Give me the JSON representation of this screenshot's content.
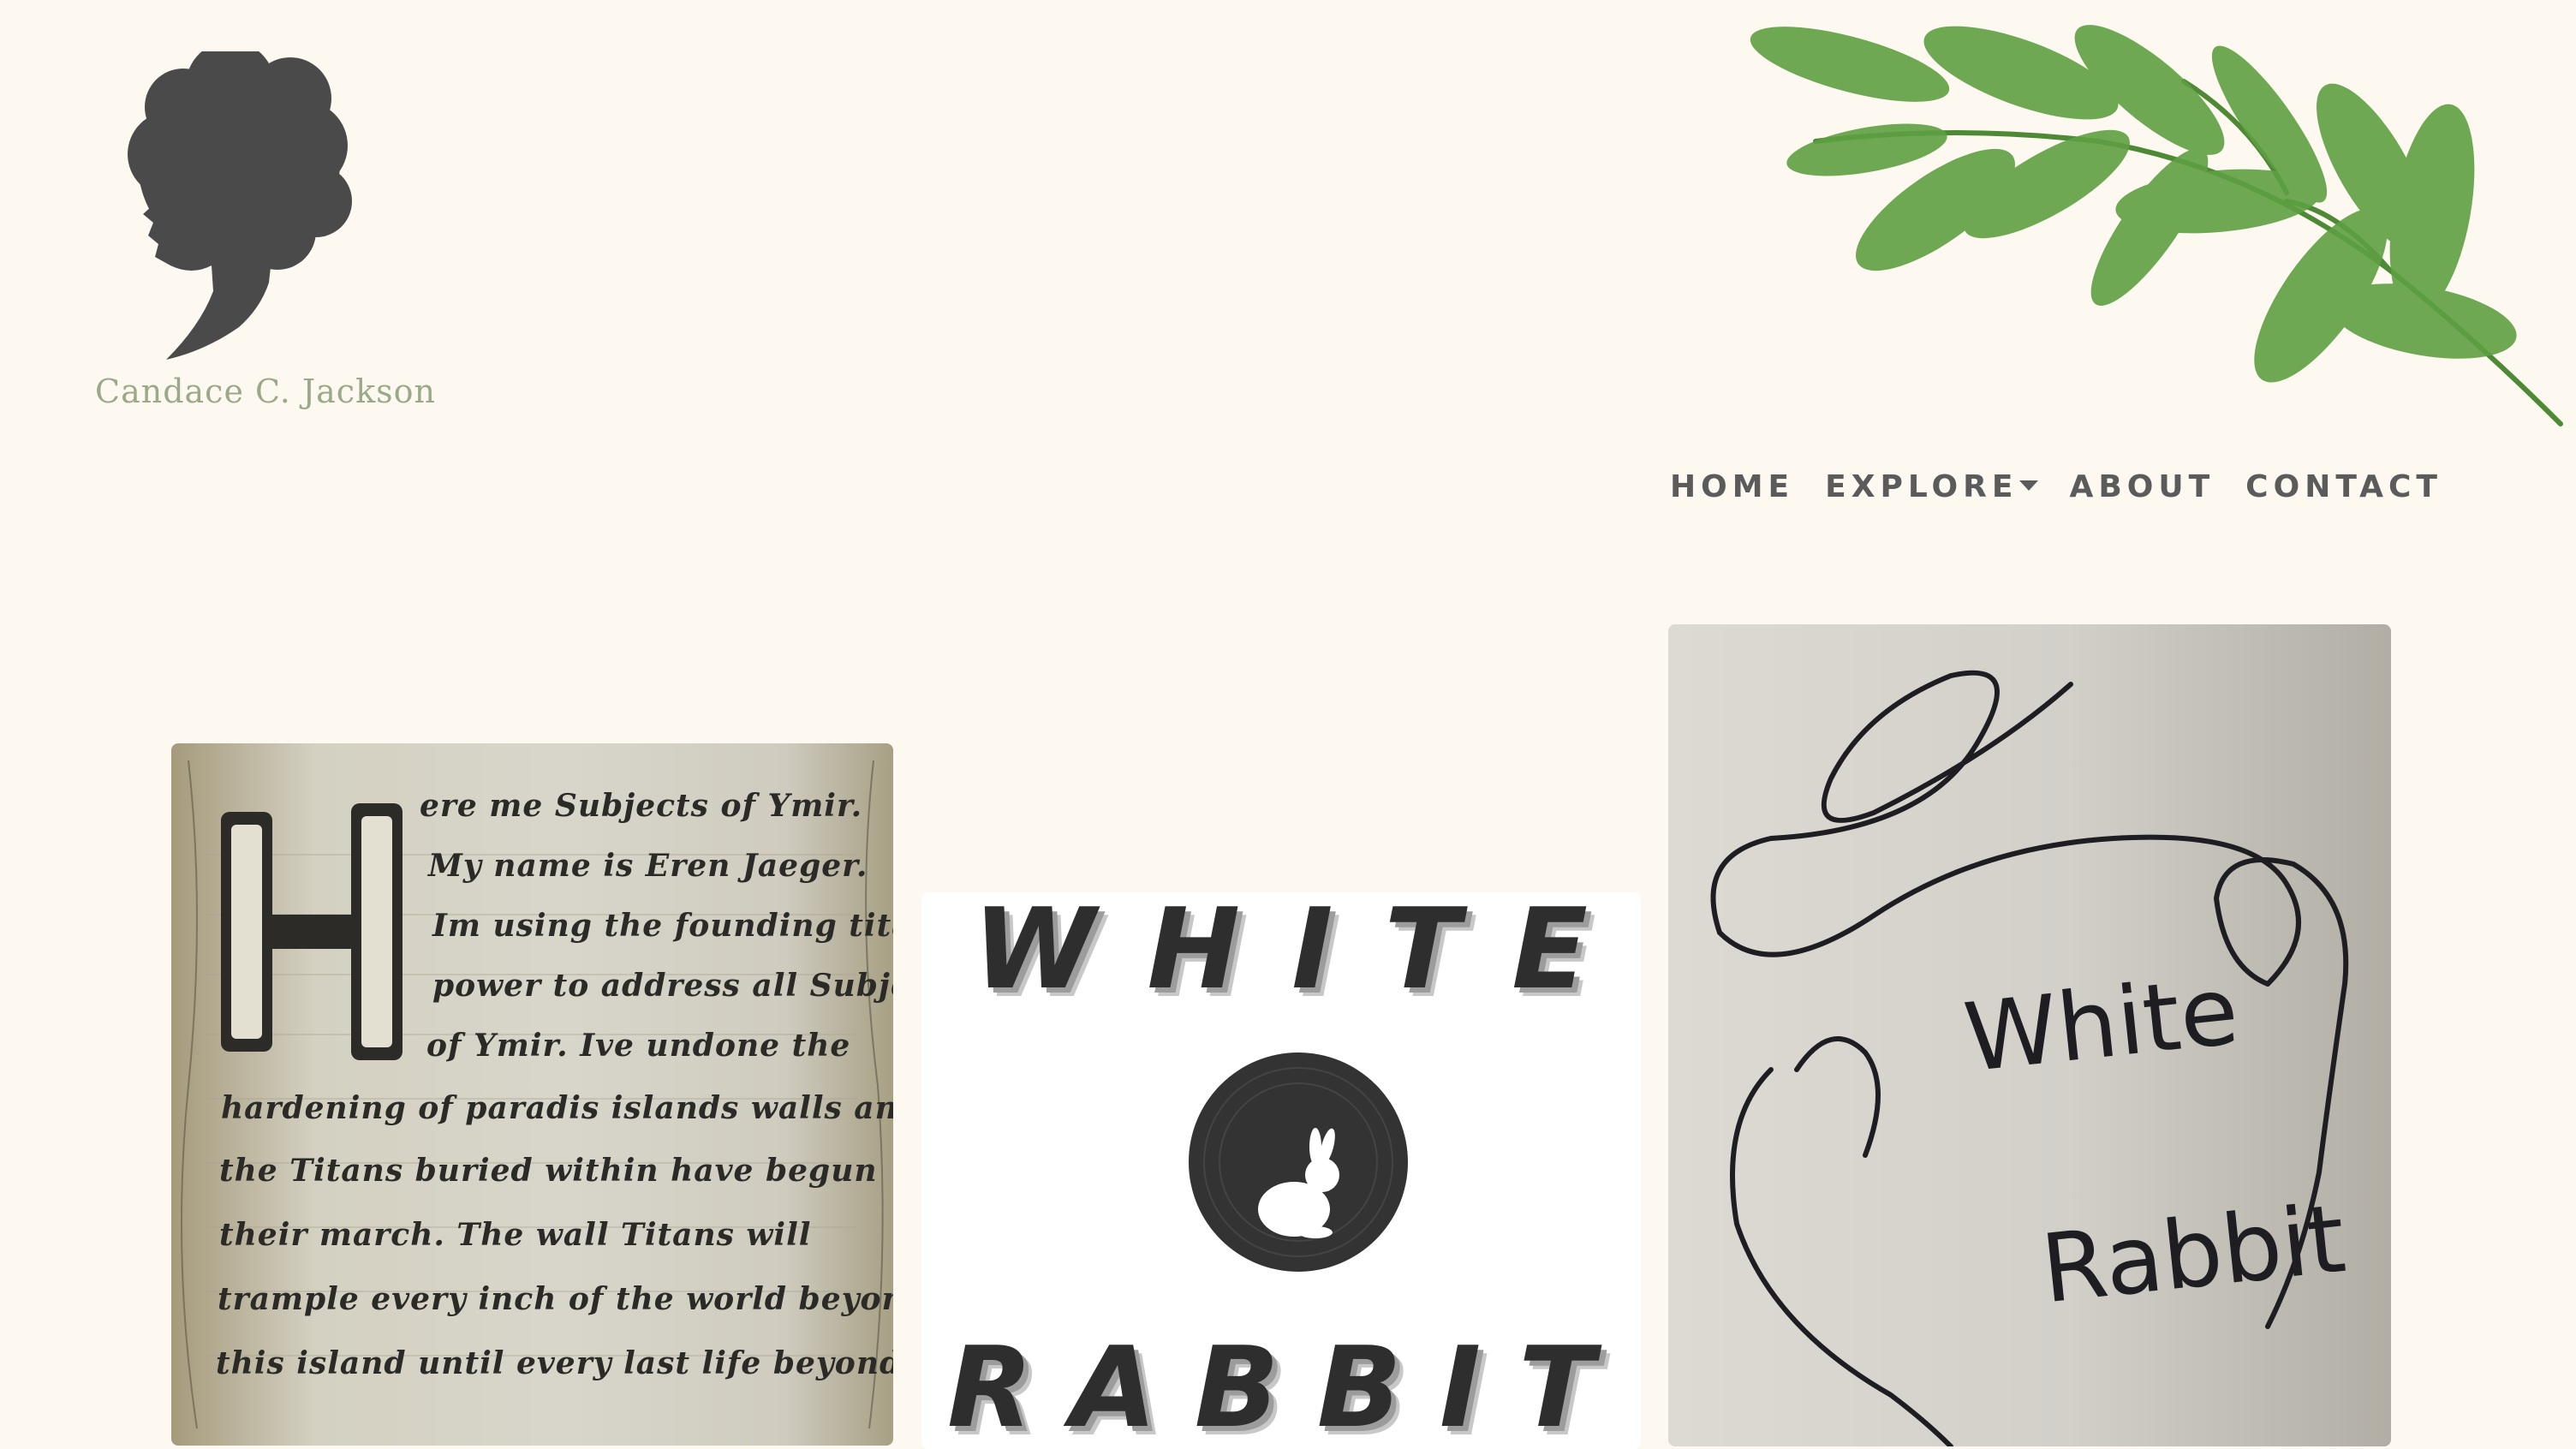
{
  "site": {
    "name": "Candace C. Jackson"
  },
  "nav": {
    "items": [
      {
        "label": "HOME"
      },
      {
        "label": "EXPLORE"
      },
      {
        "label": "ABOUT"
      },
      {
        "label": "CONTACT"
      }
    ]
  },
  "gallery": {
    "card1": {
      "lines": [
        "ere me Subjects of Ymir.",
        "My name is Eren Jaeger.",
        "Im using the founding titans",
        "power to address all Subjects",
        "of Ymir. Ive undone the",
        "hardening of paradis islands walls and",
        "the Titans buried within have begun",
        "their march. The wall Titans will",
        "trample every inch of the world beyond",
        "this island until every last life beyond"
      ],
      "initial": "H"
    },
    "card2": {
      "top_word": "WHITE",
      "bottom_word": "RABBIT"
    },
    "card3": {
      "line1": "White",
      "line2": "Rabbit"
    }
  },
  "colors": {
    "background": "#fdf9f1",
    "silhouette": "#4a4a4a",
    "site_name": "#9aa987",
    "nav_text": "#5b5b5b",
    "leaf_green": "#5fa043"
  },
  "icons": {
    "logo": "woman-silhouette-icon",
    "decor": "leaf-branch-icon",
    "dropdown": "caret-down-icon",
    "rabbit": "rabbit-icon"
  }
}
